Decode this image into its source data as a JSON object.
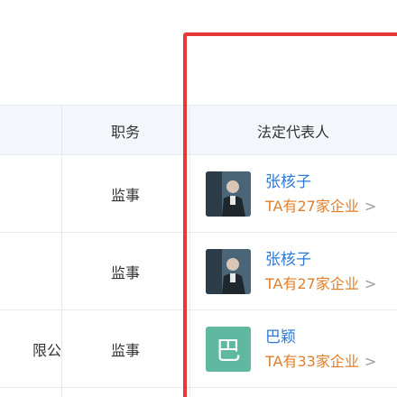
{
  "table": {
    "headers": {
      "company": "",
      "duty": "职务",
      "legal_rep": "法定代表人"
    },
    "rows": [
      {
        "company": "",
        "duty": "监事",
        "rep_name": "张核子",
        "rep_meta": "TA有27家企业",
        "avatar_type": "photo",
        "avatar_letter": ""
      },
      {
        "company": "",
        "duty": "监事",
        "rep_name": "张核子",
        "rep_meta": "TA有27家企业",
        "avatar_type": "photo",
        "avatar_letter": ""
      },
      {
        "company": "限公",
        "duty": "监事",
        "rep_name": "巴颖",
        "rep_meta": "TA有33家企业",
        "avatar_type": "letter",
        "avatar_letter": "巴"
      }
    ],
    "arrow_glyph": ">"
  },
  "colors": {
    "highlight": "#e53935",
    "link": "#2b78d6",
    "meta": "#e07f2b",
    "avatar_letter_bg": "#5fb8a0",
    "header_bg": "#f3f6fb"
  }
}
